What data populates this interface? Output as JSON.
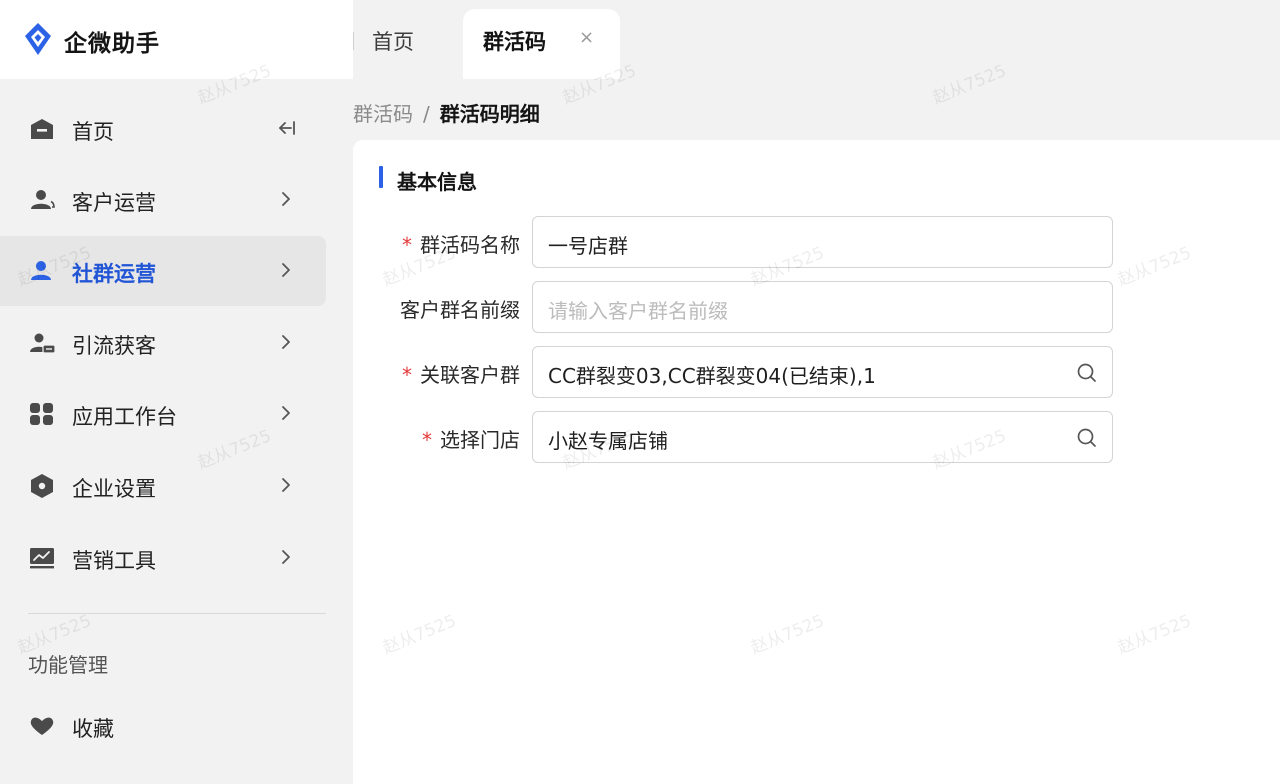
{
  "app": {
    "title": "企微助手",
    "brand_color": "#2c63e6",
    "logo_icon": "brand-diamond-icon"
  },
  "tabs": [
    {
      "label": "首页"
    },
    {
      "label": "群活码",
      "active": true,
      "close_symbol": "×"
    }
  ],
  "breadcrumb": {
    "parent": "群活码",
    "separator": "/",
    "current": "群活码明细"
  },
  "sidebar": {
    "items": [
      {
        "label": "首页",
        "icon": "home-icon",
        "trailing": "collapse-icon"
      },
      {
        "label": "客户运营",
        "icon": "customers-icon",
        "trailing": "chevron-right-icon"
      },
      {
        "label": "社群运营",
        "icon": "community-icon",
        "trailing": "chevron-right-icon",
        "active": true
      },
      {
        "label": "引流获客",
        "icon": "user-acquisition-icon",
        "trailing": "chevron-right-icon"
      },
      {
        "label": "应用工作台",
        "icon": "apps-grid-icon",
        "trailing": "chevron-right-icon"
      },
      {
        "label": "企业设置",
        "icon": "settings-hexagon-icon",
        "trailing": "chevron-right-icon"
      },
      {
        "label": "营销工具",
        "icon": "chart-icon",
        "trailing": "chevron-right-icon"
      }
    ],
    "section_title": "功能管理",
    "extra_items": [
      {
        "label": "收藏",
        "icon": "heart-icon"
      }
    ]
  },
  "form": {
    "section_title": "基本信息",
    "fields": [
      {
        "label": "群活码名称",
        "required": true,
        "value": "一号店群",
        "placeholder": ""
      },
      {
        "label": "客户群名前缀",
        "required": false,
        "value": "",
        "placeholder": "请输入客户群名前缀"
      },
      {
        "label": "关联客户群",
        "required": true,
        "value": "CC群裂变03,CC群裂变04(已结束),1",
        "placeholder": "",
        "icon": "search-icon"
      },
      {
        "label": "选择门店",
        "required": true,
        "value": "小赵专属店铺",
        "placeholder": "",
        "icon": "search-icon"
      }
    ],
    "required_mark": "*"
  },
  "watermark": {
    "text": "赵从7525"
  }
}
